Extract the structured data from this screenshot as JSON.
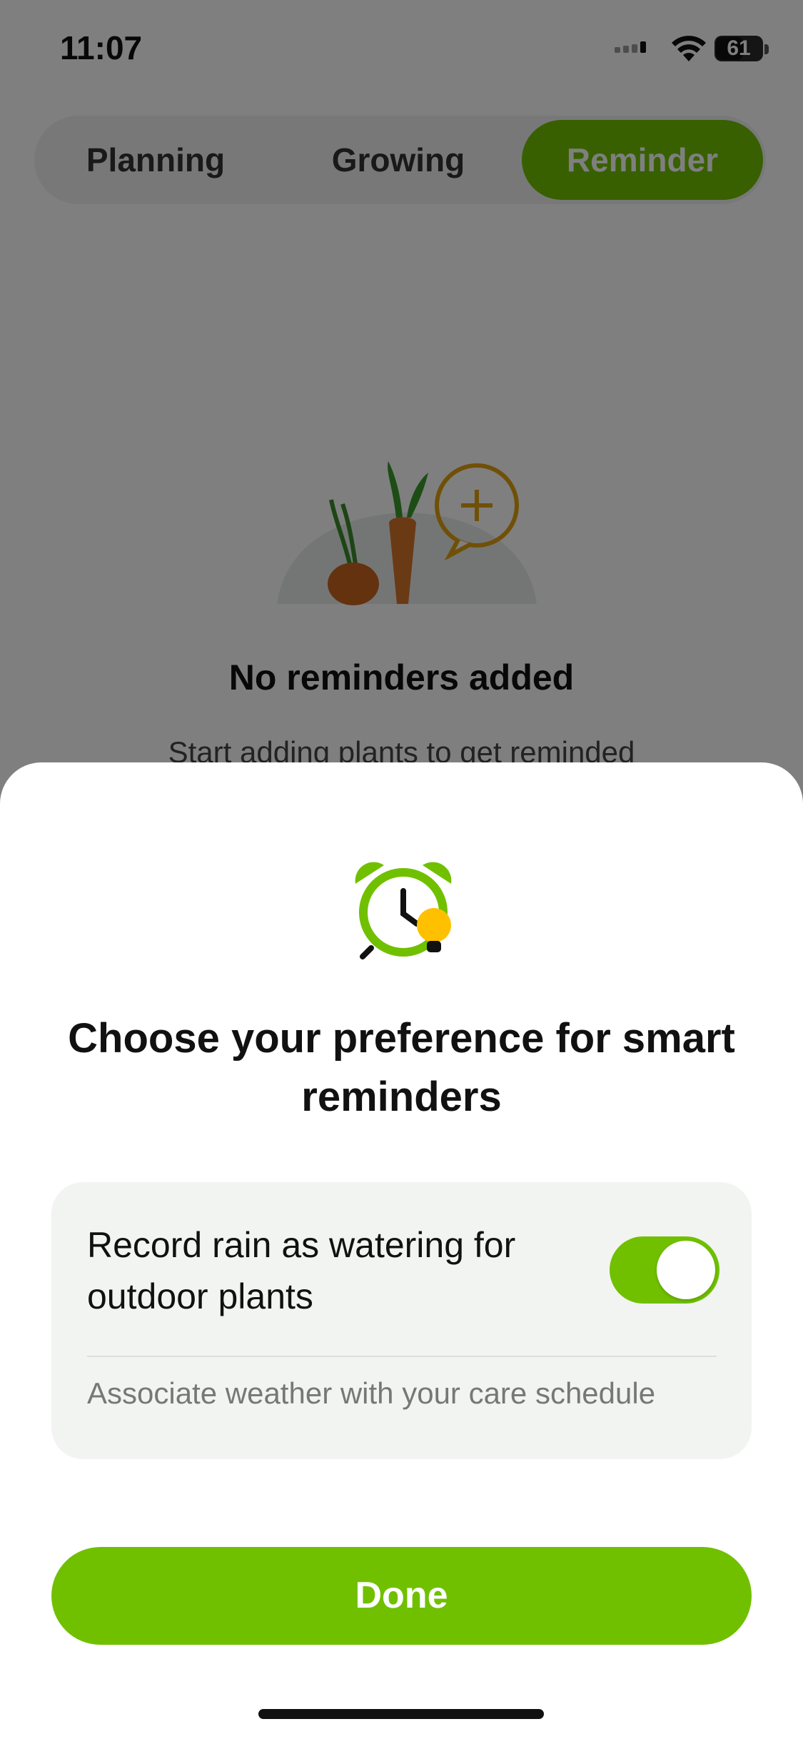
{
  "status_bar": {
    "time": "11:07",
    "battery": "61"
  },
  "tabs": [
    {
      "label": "Planning"
    },
    {
      "label": "Growing"
    },
    {
      "label": "Reminder",
      "selected": true
    }
  ],
  "empty_state": {
    "title": "No reminders added",
    "subtitle": "Start adding plants to get reminded"
  },
  "sheet": {
    "icon": "alarm-clock-bulb-icon",
    "title": "Choose your preference for smart reminders",
    "preference": {
      "label": "Record rain as watering for outdoor plants",
      "enabled": true,
      "description": "Associate weather with your care schedule"
    },
    "done_label": "Done"
  },
  "colors": {
    "accent": "#70c000",
    "overlay": "rgba(0,0,0,0.5)"
  }
}
